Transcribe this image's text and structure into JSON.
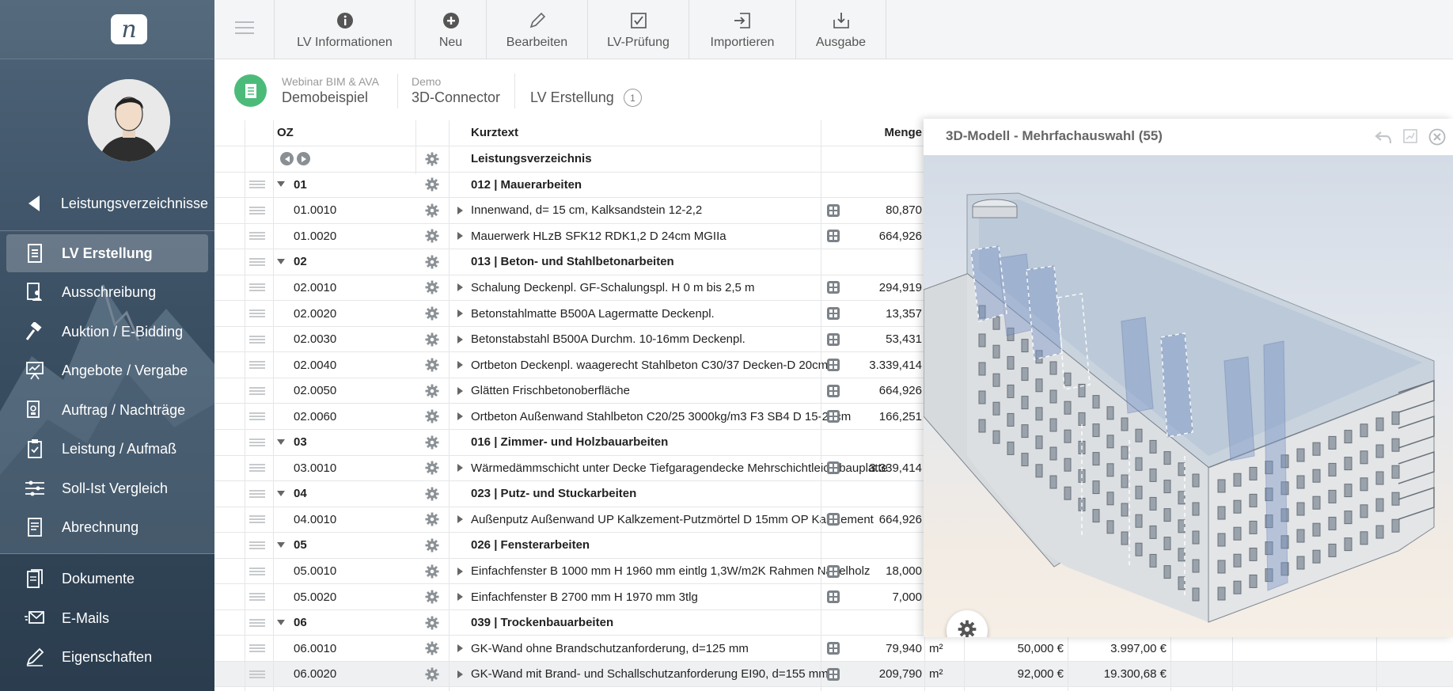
{
  "app": {
    "logo_letter": "n"
  },
  "sidebar": {
    "items": [
      {
        "label": "Leistungsverzeichnisse",
        "icon": "chevron-left-icon"
      },
      {
        "label": "LV Erstellung",
        "icon": "document-list-icon",
        "active": true
      },
      {
        "label": "Ausschreibung",
        "icon": "document-person-icon"
      },
      {
        "label": "Auktion / E-Bidding",
        "icon": "gavel-icon"
      },
      {
        "label": "Angebote / Vergabe",
        "icon": "presentation-chart-icon"
      },
      {
        "label": "Auftrag / Nachträge",
        "icon": "document-stamp-icon"
      },
      {
        "label": "Leistung / Aufmaß",
        "icon": "clipboard-check-icon"
      },
      {
        "label": "Soll-Ist Vergleich",
        "icon": "sliders-icon"
      },
      {
        "label": "Abrechnung",
        "icon": "document-lines-icon"
      },
      {
        "label": "Dokumente",
        "icon": "documents-icon"
      },
      {
        "label": "E-Mails",
        "icon": "mail-send-icon"
      },
      {
        "label": "Eigenschaften",
        "icon": "pencil-icon"
      }
    ]
  },
  "toolbar": {
    "buttons": [
      {
        "label": "LV Informationen",
        "icon": "info-icon"
      },
      {
        "label": "Neu",
        "icon": "plus-circle-icon"
      },
      {
        "label": "Bearbeiten",
        "icon": "pencil-icon"
      },
      {
        "label": "LV-Prüfung",
        "icon": "checkbox-icon"
      },
      {
        "label": "Importieren",
        "icon": "import-icon"
      },
      {
        "label": "Ausgabe",
        "icon": "download-tray-icon"
      }
    ]
  },
  "header": {
    "project_small": "Webinar BIM & AVA",
    "project": "Demobeispiel",
    "lv_small": "Demo",
    "lv": "3D-Connector",
    "section": "LV Erstellung",
    "count": "1"
  },
  "table": {
    "columns": {
      "oz": "OZ",
      "kurztext": "Kurztext",
      "menge": "Menge"
    },
    "root_label": "Leistungsverzeichnis",
    "rows": [
      {
        "type": "group",
        "oz": "01",
        "text": "012 | Mauerarbeiten"
      },
      {
        "type": "item",
        "oz": "01.0010",
        "text": "Innenwand, d= 15 cm, Kalksandstein 12-2,2",
        "menge": "80,870"
      },
      {
        "type": "item",
        "oz": "01.0020",
        "text": "Mauerwerk HLzB SFK12 RDK1,2 D 24cm MGIIa",
        "menge": "664,926"
      },
      {
        "type": "group",
        "oz": "02",
        "text": "013 | Beton- und Stahlbetonarbeiten"
      },
      {
        "type": "item",
        "oz": "02.0010",
        "text": "Schalung Deckenpl. GF-Schalungspl. H 0 m bis 2,5 m",
        "menge": "294,919"
      },
      {
        "type": "item",
        "oz": "02.0020",
        "text": "Betonstahlmatte B500A Lagermatte Deckenpl.",
        "menge": "13,357"
      },
      {
        "type": "item",
        "oz": "02.0030",
        "text": "Betonstabstahl B500A Durchm. 10-16mm Deckenpl.",
        "menge": "53,431"
      },
      {
        "type": "item",
        "oz": "02.0040",
        "text": "Ortbeton Deckenpl. waagerecht Stahlbeton C30/37 Decken-D 20cm",
        "menge": "3.339,414"
      },
      {
        "type": "item",
        "oz": "02.0050",
        "text": "Glätten Frischbetonoberfläche",
        "menge": "664,926"
      },
      {
        "type": "item",
        "oz": "02.0060",
        "text": "Ortbeton Außenwand Stahlbeton C20/25 3000kg/m3 F3 SB4 D 15-25cm",
        "menge": "166,251"
      },
      {
        "type": "group",
        "oz": "03",
        "text": "016 | Zimmer- und Holzbauarbeiten"
      },
      {
        "type": "item",
        "oz": "03.0010",
        "text": "Wärmedämmschicht unter Decke Tiefgaragendecke Mehrschichtleichtbauplatte",
        "menge": "3.339,414"
      },
      {
        "type": "group",
        "oz": "04",
        "text": "023 | Putz- und Stuckarbeiten"
      },
      {
        "type": "item",
        "oz": "04.0010",
        "text": "Außenputz Außenwand UP Kalkzement-Putzmörtel D 15mm OP Kalkzement",
        "menge": "664,926"
      },
      {
        "type": "group",
        "oz": "05",
        "text": "026 | Fensterarbeiten"
      },
      {
        "type": "item",
        "oz": "05.0010",
        "text": "Einfachfenster B 1000 mm H 1960 mm eintlg 1,3W/m2K Rahmen Nadelholz",
        "menge": "18,000"
      },
      {
        "type": "item",
        "oz": "05.0020",
        "text": "Einfachfenster B 2700 mm H 1970 mm 3tlg",
        "menge": "7,000"
      },
      {
        "type": "group",
        "oz": "06",
        "text": "039 | Trockenbauarbeiten"
      },
      {
        "type": "item",
        "oz": "06.0010",
        "text": "GK-Wand ohne Brandschutzanforderung, d=125 mm",
        "menge": "79,940",
        "unit": "m²",
        "ep": "50,000 €",
        "gp": "3.997,00 €"
      },
      {
        "type": "item",
        "oz": "06.0020",
        "text": "GK-Wand mit Brand- und Schallschutzanforderung EI90, d=155 mm",
        "menge": "209,790",
        "unit": "m²",
        "ep": "92,000 €",
        "gp": "19.300,68 €",
        "selected": true
      }
    ]
  },
  "panel": {
    "title": "3D-Modell - Mehrfachauswahl (55)"
  },
  "colors": {
    "accent_green": "#4cbb7a",
    "sidebar": "#3f5468",
    "active_nav": "rgba(255,255,255,0.22)"
  }
}
